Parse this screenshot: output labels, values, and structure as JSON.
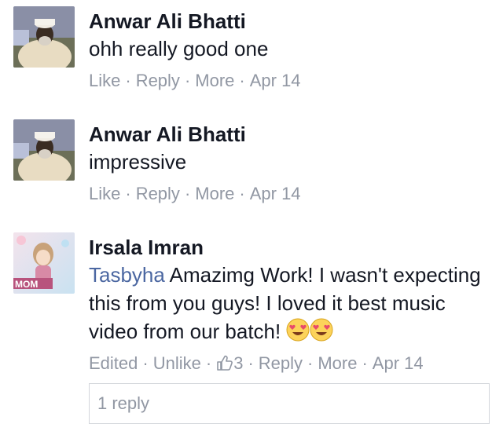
{
  "comments": [
    {
      "author": "Anwar Ali Bhatti",
      "text": "ohh really good one",
      "actions": {
        "like": "Like",
        "reply": "Reply",
        "more": "More",
        "date": "Apr 14"
      }
    },
    {
      "author": "Anwar Ali Bhatti",
      "text": "impressive",
      "actions": {
        "like": "Like",
        "reply": "Reply",
        "more": "More",
        "date": "Apr 14"
      }
    },
    {
      "author": "Irsala Imran",
      "mention": "Tasbyha",
      "text": " Amazimg Work! I wasn't expecting this from you guys! I loved it best music video from our batch!",
      "actions": {
        "edited": "Edited",
        "unlike": "Unlike",
        "like_count": "3",
        "reply": "Reply",
        "more": "More",
        "date": "Apr 14"
      }
    }
  ],
  "replies": {
    "label": "1 reply"
  },
  "avatar3_text": "MOM",
  "icons": [
    "heart-eyes-emoji",
    "thumbs-up-icon"
  ],
  "colors": {
    "link": "#4b67a1",
    "meta": "#9197a3",
    "text": "#141823",
    "border": "#d3d6db"
  }
}
